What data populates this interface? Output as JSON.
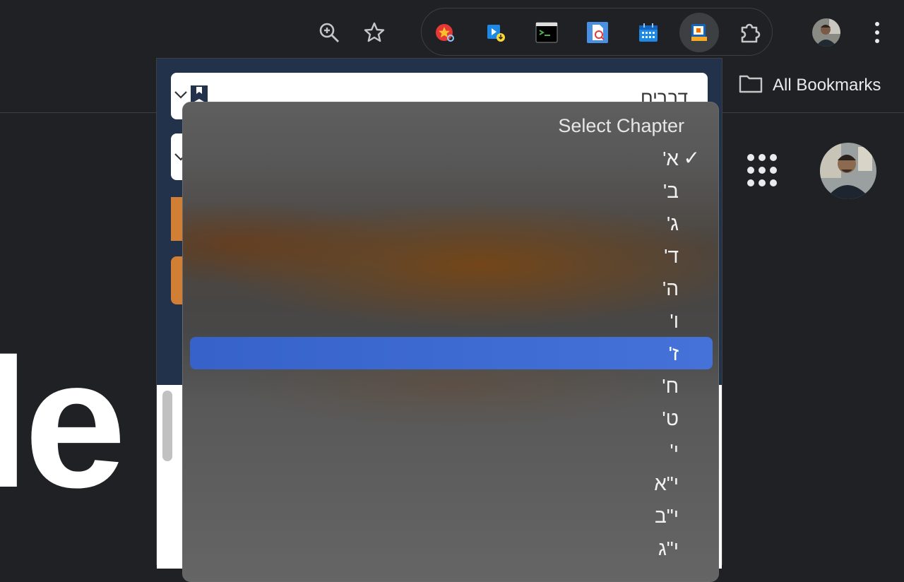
{
  "bookmarks": {
    "all_bookmarks_label": "All Bookmarks"
  },
  "page": {
    "logo_fragment": "le"
  },
  "popup": {
    "book_value": "דברים",
    "dropdown": {
      "header": "Select Chapter",
      "checkmark": "✓",
      "items": [
        "א'",
        "ב'",
        "ג'",
        "ד'",
        "ה'",
        "ו'",
        "ז'",
        "ח'",
        "ט'",
        "י'",
        "י\"א",
        "י\"ב",
        "י\"ג"
      ],
      "checked_index": 0,
      "highlighted_index": 6
    }
  },
  "colors": {
    "highlight": "#3b66cf",
    "accent_orange": "#d27f36",
    "popup_header_bg": "#22324a"
  }
}
